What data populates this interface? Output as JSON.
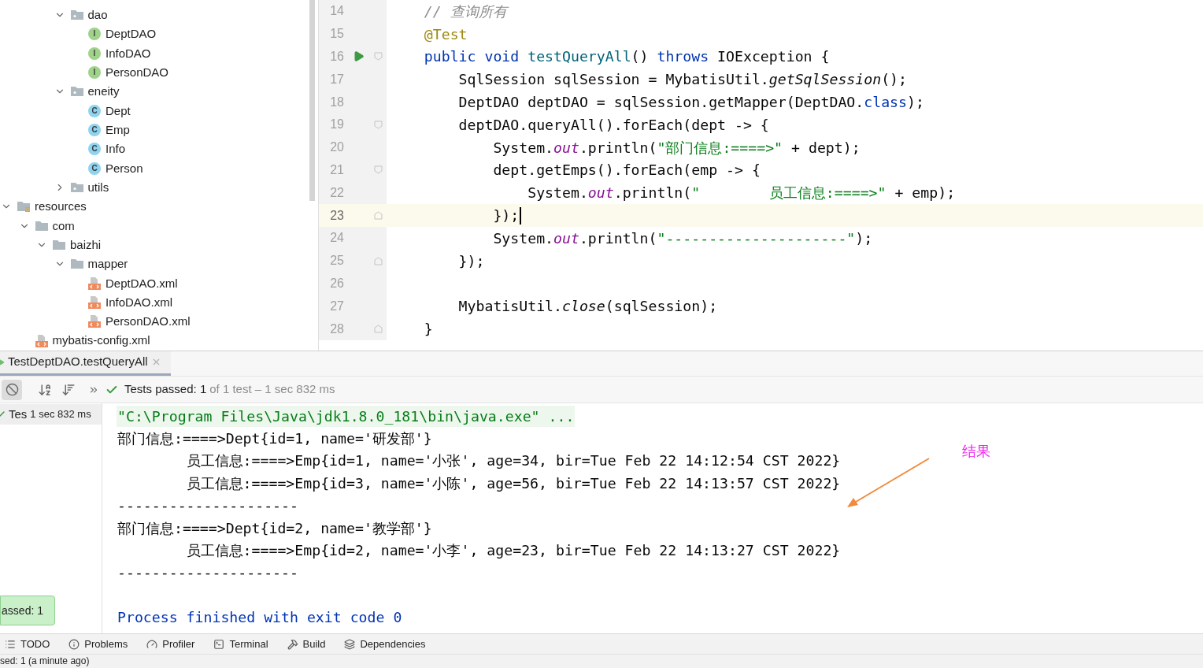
{
  "project_tree": {
    "scrolled_branch": [
      {
        "label": "dao",
        "kind": "package",
        "expanded": true,
        "children": [
          {
            "label": "DeptDAO",
            "kind": "interface",
            "badge": "I"
          },
          {
            "label": "InfoDAO",
            "kind": "interface",
            "badge": "I"
          },
          {
            "label": "PersonDAO",
            "kind": "interface",
            "badge": "I"
          }
        ]
      },
      {
        "label": "eneity",
        "kind": "package",
        "expanded": true,
        "children": [
          {
            "label": "Dept",
            "kind": "class",
            "badge": "C"
          },
          {
            "label": "Emp",
            "kind": "class",
            "badge": "C"
          },
          {
            "label": "Info",
            "kind": "class",
            "badge": "C"
          },
          {
            "label": "Person",
            "kind": "class",
            "badge": "C"
          }
        ]
      },
      {
        "label": "utils",
        "kind": "package",
        "expanded": false
      }
    ],
    "items": [
      {
        "label": "resources",
        "kind": "resources",
        "expanded": true,
        "children": [
          {
            "label": "com",
            "kind": "folder",
            "expanded": true,
            "children": [
              {
                "label": "baizhi",
                "kind": "folder",
                "expanded": true,
                "children": [
                  {
                    "label": "mapper",
                    "kind": "folder",
                    "expanded": true,
                    "children": [
                      {
                        "label": "DeptDAO.xml",
                        "kind": "xml"
                      },
                      {
                        "label": "InfoDAO.xml",
                        "kind": "xml"
                      },
                      {
                        "label": "PersonDAO.xml",
                        "kind": "xml"
                      }
                    ]
                  }
                ]
              }
            ]
          },
          {
            "label": "mybatis-config.xml",
            "kind": "xml"
          }
        ]
      }
    ]
  },
  "editor": {
    "lines": [
      {
        "number": "14",
        "current": false,
        "run_marker": false,
        "fold_start": false,
        "fold_end": false,
        "tokens": [
          {
            "kind": "comment",
            "text": "    // 查询所有"
          }
        ]
      },
      {
        "number": "15",
        "current": false,
        "run_marker": false,
        "fold_start": false,
        "fold_end": false,
        "tokens": [
          {
            "kind": "annotation",
            "text": "    @Test"
          }
        ]
      },
      {
        "number": "16",
        "current": false,
        "run_marker": true,
        "fold_start": true,
        "fold_end": false,
        "tokens": [
          {
            "kind": "keyword",
            "text": "    public void "
          },
          {
            "kind": "declaration",
            "text": "testQueryAll"
          },
          {
            "kind": "plain",
            "text": "() "
          },
          {
            "kind": "keyword",
            "text": "throws"
          },
          {
            "kind": "plain",
            "text": " IOException {"
          }
        ]
      },
      {
        "number": "17",
        "current": false,
        "run_marker": false,
        "fold_start": false,
        "fold_end": false,
        "tokens": [
          {
            "kind": "plain",
            "text": "        SqlSession sqlSession = MybatisUtil."
          },
          {
            "kind": "static",
            "text": "getSqlSession"
          },
          {
            "kind": "plain",
            "text": "();"
          }
        ]
      },
      {
        "number": "18",
        "current": false,
        "run_marker": false,
        "fold_start": false,
        "fold_end": false,
        "tokens": [
          {
            "kind": "plain",
            "text": "        DeptDAO deptDAO = sqlSession.getMapper(DeptDAO."
          },
          {
            "kind": "keyword",
            "text": "class"
          },
          {
            "kind": "plain",
            "text": ");"
          }
        ]
      },
      {
        "number": "19",
        "current": false,
        "run_marker": false,
        "fold_start": true,
        "fold_end": false,
        "tokens": [
          {
            "kind": "plain",
            "text": "        deptDAO.queryAll().forEach(dept -> {"
          }
        ]
      },
      {
        "number": "20",
        "current": false,
        "run_marker": false,
        "fold_start": false,
        "fold_end": false,
        "tokens": [
          {
            "kind": "plain",
            "text": "            System."
          },
          {
            "kind": "field",
            "text": "out"
          },
          {
            "kind": "plain",
            "text": ".println("
          },
          {
            "kind": "string",
            "text": "\"部门信息:====>\""
          },
          {
            "kind": "plain",
            "text": " + dept);"
          }
        ]
      },
      {
        "number": "21",
        "current": false,
        "run_marker": false,
        "fold_start": true,
        "fold_end": false,
        "tokens": [
          {
            "kind": "plain",
            "text": "            dept.getEmps().forEach(emp -> {"
          }
        ]
      },
      {
        "number": "22",
        "current": false,
        "run_marker": false,
        "fold_start": false,
        "fold_end": false,
        "tokens": [
          {
            "kind": "plain",
            "text": "                System."
          },
          {
            "kind": "field",
            "text": "out"
          },
          {
            "kind": "plain",
            "text": ".println("
          },
          {
            "kind": "string",
            "text": "\"        员工信息:====>\""
          },
          {
            "kind": "plain",
            "text": " + emp);"
          }
        ]
      },
      {
        "number": "23",
        "current": true,
        "run_marker": false,
        "fold_start": false,
        "fold_end": true,
        "tokens": [
          {
            "kind": "plain",
            "text": "            });"
          }
        ]
      },
      {
        "number": "24",
        "current": false,
        "run_marker": false,
        "fold_start": false,
        "fold_end": false,
        "tokens": [
          {
            "kind": "plain",
            "text": "            System."
          },
          {
            "kind": "field",
            "text": "out"
          },
          {
            "kind": "plain",
            "text": ".println("
          },
          {
            "kind": "string",
            "text": "\"---------------------\""
          },
          {
            "kind": "plain",
            "text": ");"
          }
        ]
      },
      {
        "number": "25",
        "current": false,
        "run_marker": false,
        "fold_start": false,
        "fold_end": true,
        "tokens": [
          {
            "kind": "plain",
            "text": "        });"
          }
        ]
      },
      {
        "number": "26",
        "current": false,
        "run_marker": false,
        "fold_start": false,
        "fold_end": false
      },
      {
        "number": "27",
        "current": false,
        "run_marker": false,
        "fold_start": false,
        "fold_end": false,
        "tokens": [
          {
            "kind": "plain",
            "text": "        MybatisUtil."
          },
          {
            "kind": "static",
            "text": "close"
          },
          {
            "kind": "plain",
            "text": "(sqlSession);"
          }
        ]
      },
      {
        "number": "28",
        "current": false,
        "run_marker": false,
        "fold_start": false,
        "fold_end": true,
        "tokens": [
          {
            "kind": "plain",
            "text": "    }"
          }
        ]
      }
    ]
  },
  "run_panel": {
    "tabs": [
      {
        "label": "TestDeptDAO.testQueryAll",
        "selected": true
      }
    ],
    "summary": {
      "label": "Tests passed: 1",
      "detail": "of 1 test – 1 sec 832 ms"
    },
    "test_tree": [
      {
        "label": "Tes",
        "time": "1 sec 832 ms",
        "selected": true
      }
    ],
    "popup": "assed: 1",
    "console": [
      {
        "kind": "command",
        "text": "\"C:\\Program Files\\Java\\jdk1.8.0_181\\bin\\java.exe\" ..."
      },
      {
        "kind": "output",
        "text": "部门信息:====>Dept{id=1, name='研发部'}"
      },
      {
        "kind": "output",
        "text": "        员工信息:====>Emp{id=1, name='小张', age=34, bir=Tue Feb 22 14:12:54 CST 2022}"
      },
      {
        "kind": "output",
        "text": "        员工信息:====>Emp{id=3, name='小陈', age=56, bir=Tue Feb 22 14:13:57 CST 2022}"
      },
      {
        "kind": "output",
        "text": "---------------------"
      },
      {
        "kind": "output",
        "text": "部门信息:====>Dept{id=2, name='教学部'}"
      },
      {
        "kind": "output",
        "text": "        员工信息:====>Emp{id=2, name='小李', age=23, bir=Tue Feb 22 14:13:27 CST 2022}"
      },
      {
        "kind": "output",
        "text": "---------------------"
      },
      {
        "kind": "blank"
      },
      {
        "kind": "exit",
        "text": "Process finished with exit code 0"
      }
    ],
    "annotation": {
      "text": "结果"
    }
  },
  "tool_strip": [
    {
      "label": "TODO",
      "kind": "todo"
    },
    {
      "label": "Problems",
      "kind": "problems"
    },
    {
      "label": "Profiler",
      "kind": "profiler"
    },
    {
      "label": "Terminal",
      "kind": "terminal"
    },
    {
      "label": "Build",
      "kind": "build"
    },
    {
      "label": "Dependencies",
      "kind": "dependencies"
    }
  ],
  "status_bar": {
    "text": "sed: 1 (a minute ago)"
  }
}
